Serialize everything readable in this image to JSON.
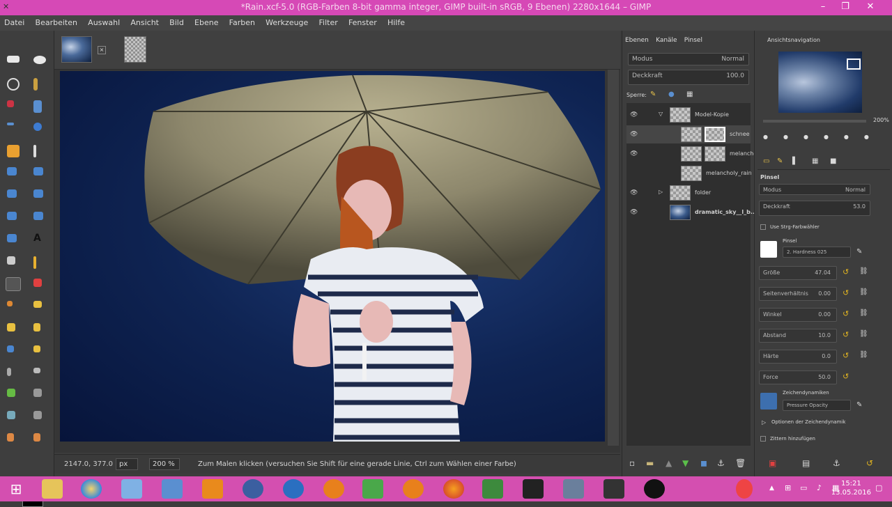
{
  "window": {
    "title": "*Rain.xcf-5.0 (RGB-Farben 8-bit gamma integer, GIMP built-in sRGB, 9 Ebenen) 2280x1644 – GIMP"
  },
  "menu": [
    "Datei",
    "Bearbeiten",
    "Auswahl",
    "Ansicht",
    "Bild",
    "Ebene",
    "Farben",
    "Werkzeuge",
    "Filter",
    "Fenster",
    "Hilfe"
  ],
  "statusbar": {
    "coords": "2147.0, 377.0",
    "unit": "px",
    "zoom": "200 %",
    "message": "Zum Malen klicken (versuchen Sie Shift für eine gerade Linie, Ctrl zum Wählen einer Farbe)"
  },
  "layers_panel": {
    "tabs": [
      "Ebenen",
      "Kanäle",
      "Pinsel"
    ],
    "mode_label": "Modus",
    "mode_value": "Normal",
    "opacity_label": "Deckkraft",
    "opacity_value": "100.0",
    "lock_label": "Sperre:",
    "layers": [
      {
        "name": "Model-Kopie"
      },
      {
        "name": "schnee"
      },
      {
        "name": "melancholy_..."
      },
      {
        "name": "melancholy_rain"
      },
      {
        "name": "folder"
      },
      {
        "name": "dramatic_sky__l_b..."
      }
    ]
  },
  "right_panel": {
    "navigation_tab": "Ansichtsnavigation",
    "zoom_value": "200%",
    "tool_options_header": "Pinsel",
    "mode_label": "Modus",
    "mode_value": "Normal",
    "opacity_label": "Deckkraft",
    "opacity_value": "53.0",
    "incremental": "Use Strg-Farbwähler",
    "brush_label": "Pinsel",
    "brush_name": "2. Hardness 025",
    "options": [
      {
        "label": "Größe",
        "value": "47.04"
      },
      {
        "label": "Seitenverhältnis",
        "value": "0.00"
      },
      {
        "label": "Winkel",
        "value": "0.00"
      },
      {
        "label": "Abstand",
        "value": "10.0"
      },
      {
        "label": "Härte",
        "value": "0.0"
      },
      {
        "label": "Force",
        "value": "50.0"
      }
    ],
    "dynamics_label": "Zeichendynamiken",
    "dynamics_value": "Pressure Opacity",
    "dynamics_options": "Optionen der Zeichendynamik",
    "jitter": "Zittern hinzufügen"
  },
  "taskbar": {
    "time": "15:21",
    "date": "13.05.2016"
  }
}
